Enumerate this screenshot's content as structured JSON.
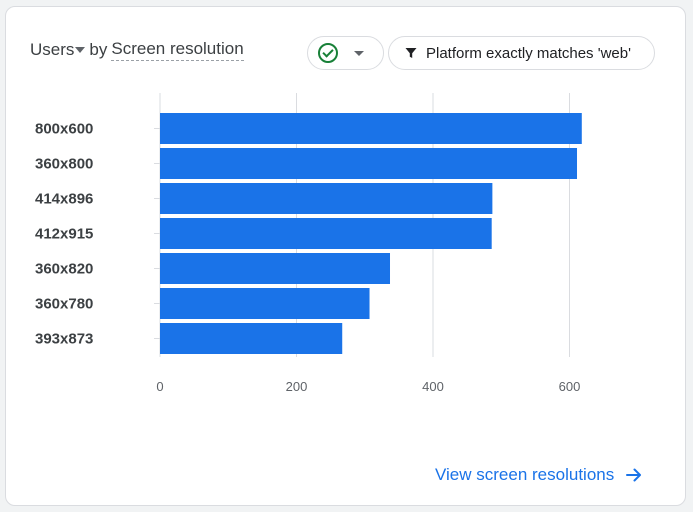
{
  "header": {
    "metric_label": "Users",
    "by_label": "by",
    "dimension_label": "Screen resolution"
  },
  "comparison": {
    "icon": "check-circle-icon",
    "color": "#188038"
  },
  "filter": {
    "label": "Platform exactly matches 'web'",
    "icon": "filter-icon"
  },
  "footer": {
    "link_label": "View screen resolutions",
    "icon": "arrow-right-icon"
  },
  "colors": {
    "bar": "#1a73e8",
    "link": "#1a73e8",
    "grid": "#dadce0"
  },
  "chart_data": {
    "type": "bar",
    "orientation": "horizontal",
    "categories": [
      "800x600",
      "360x800",
      "414x896",
      "412x915",
      "360x820",
      "360x780",
      "393x873"
    ],
    "values": [
      618,
      611,
      487,
      486,
      337,
      307,
      267
    ],
    "xticks": [
      0,
      200,
      400,
      600
    ],
    "xlim": [
      0,
      650
    ],
    "grid": true,
    "title": "",
    "xlabel": "",
    "ylabel": ""
  }
}
